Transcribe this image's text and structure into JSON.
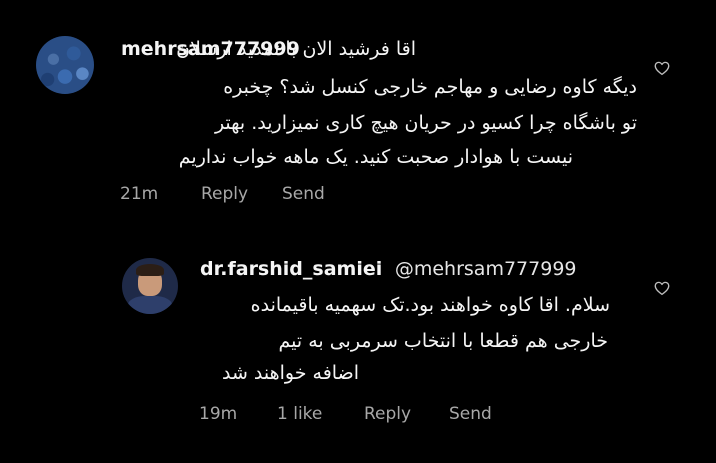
{
  "comments": [
    {
      "username": "mehrsam777999",
      "text_lines": [
        "اقا فرشید الان با تمدید ارسلان",
        "دیگه کاوه رضایی و مهاجم خارجی کنسل شد؟ چخبره",
        "تو باشگاه چرا کسیو در حریان هیچ کاری نمیزارید. بهتر",
        "نیست با هوادار صحبت کنید. یک ماهه خواب نداریم"
      ],
      "time": "21m",
      "reply_label": "Reply",
      "send_label": "Send"
    },
    {
      "username": "dr.farshid_samiei",
      "mention": "@mehrsam777999",
      "text_lines": [
        "سلام. اقا کاوه خواهند بود.تک سهمیه باقیمانده",
        "خارجی هم قطعا با انتخاب سرمربی به تیم",
        "اضافه خواهند شد"
      ],
      "time": "19m",
      "likes": "1 like",
      "reply_label": "Reply",
      "send_label": "Send"
    }
  ],
  "icons": {
    "like": "heart-outline-icon"
  },
  "colors": {
    "background": "#000000",
    "text": "#f5f5f5",
    "meta": "#a8a8a8"
  }
}
